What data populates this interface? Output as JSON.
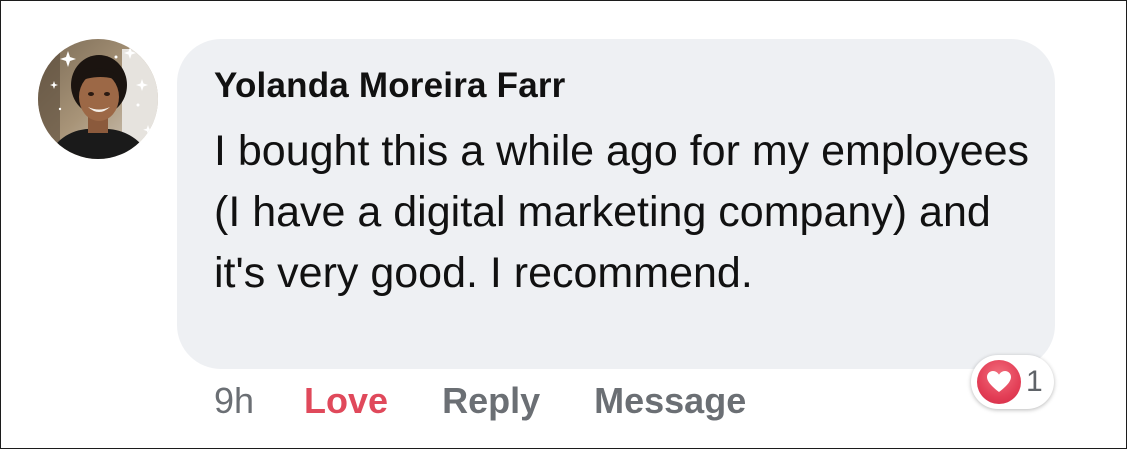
{
  "comment": {
    "author": "Yolanda Moreira Farr",
    "text": "I bought this a while ago for my employees (I have a digital marketing company) and it's very good. I recommend.",
    "timestamp": "9h",
    "actions": {
      "love_label": "Love",
      "reply_label": "Reply",
      "message_label": "Message"
    },
    "reactions": {
      "icon": "heart-icon",
      "count": "1"
    }
  },
  "colors": {
    "bubble": "#eef0f3",
    "love_active": "#e0495b",
    "action_gray": "#6b6f74",
    "heart_red": "#e33e56"
  }
}
